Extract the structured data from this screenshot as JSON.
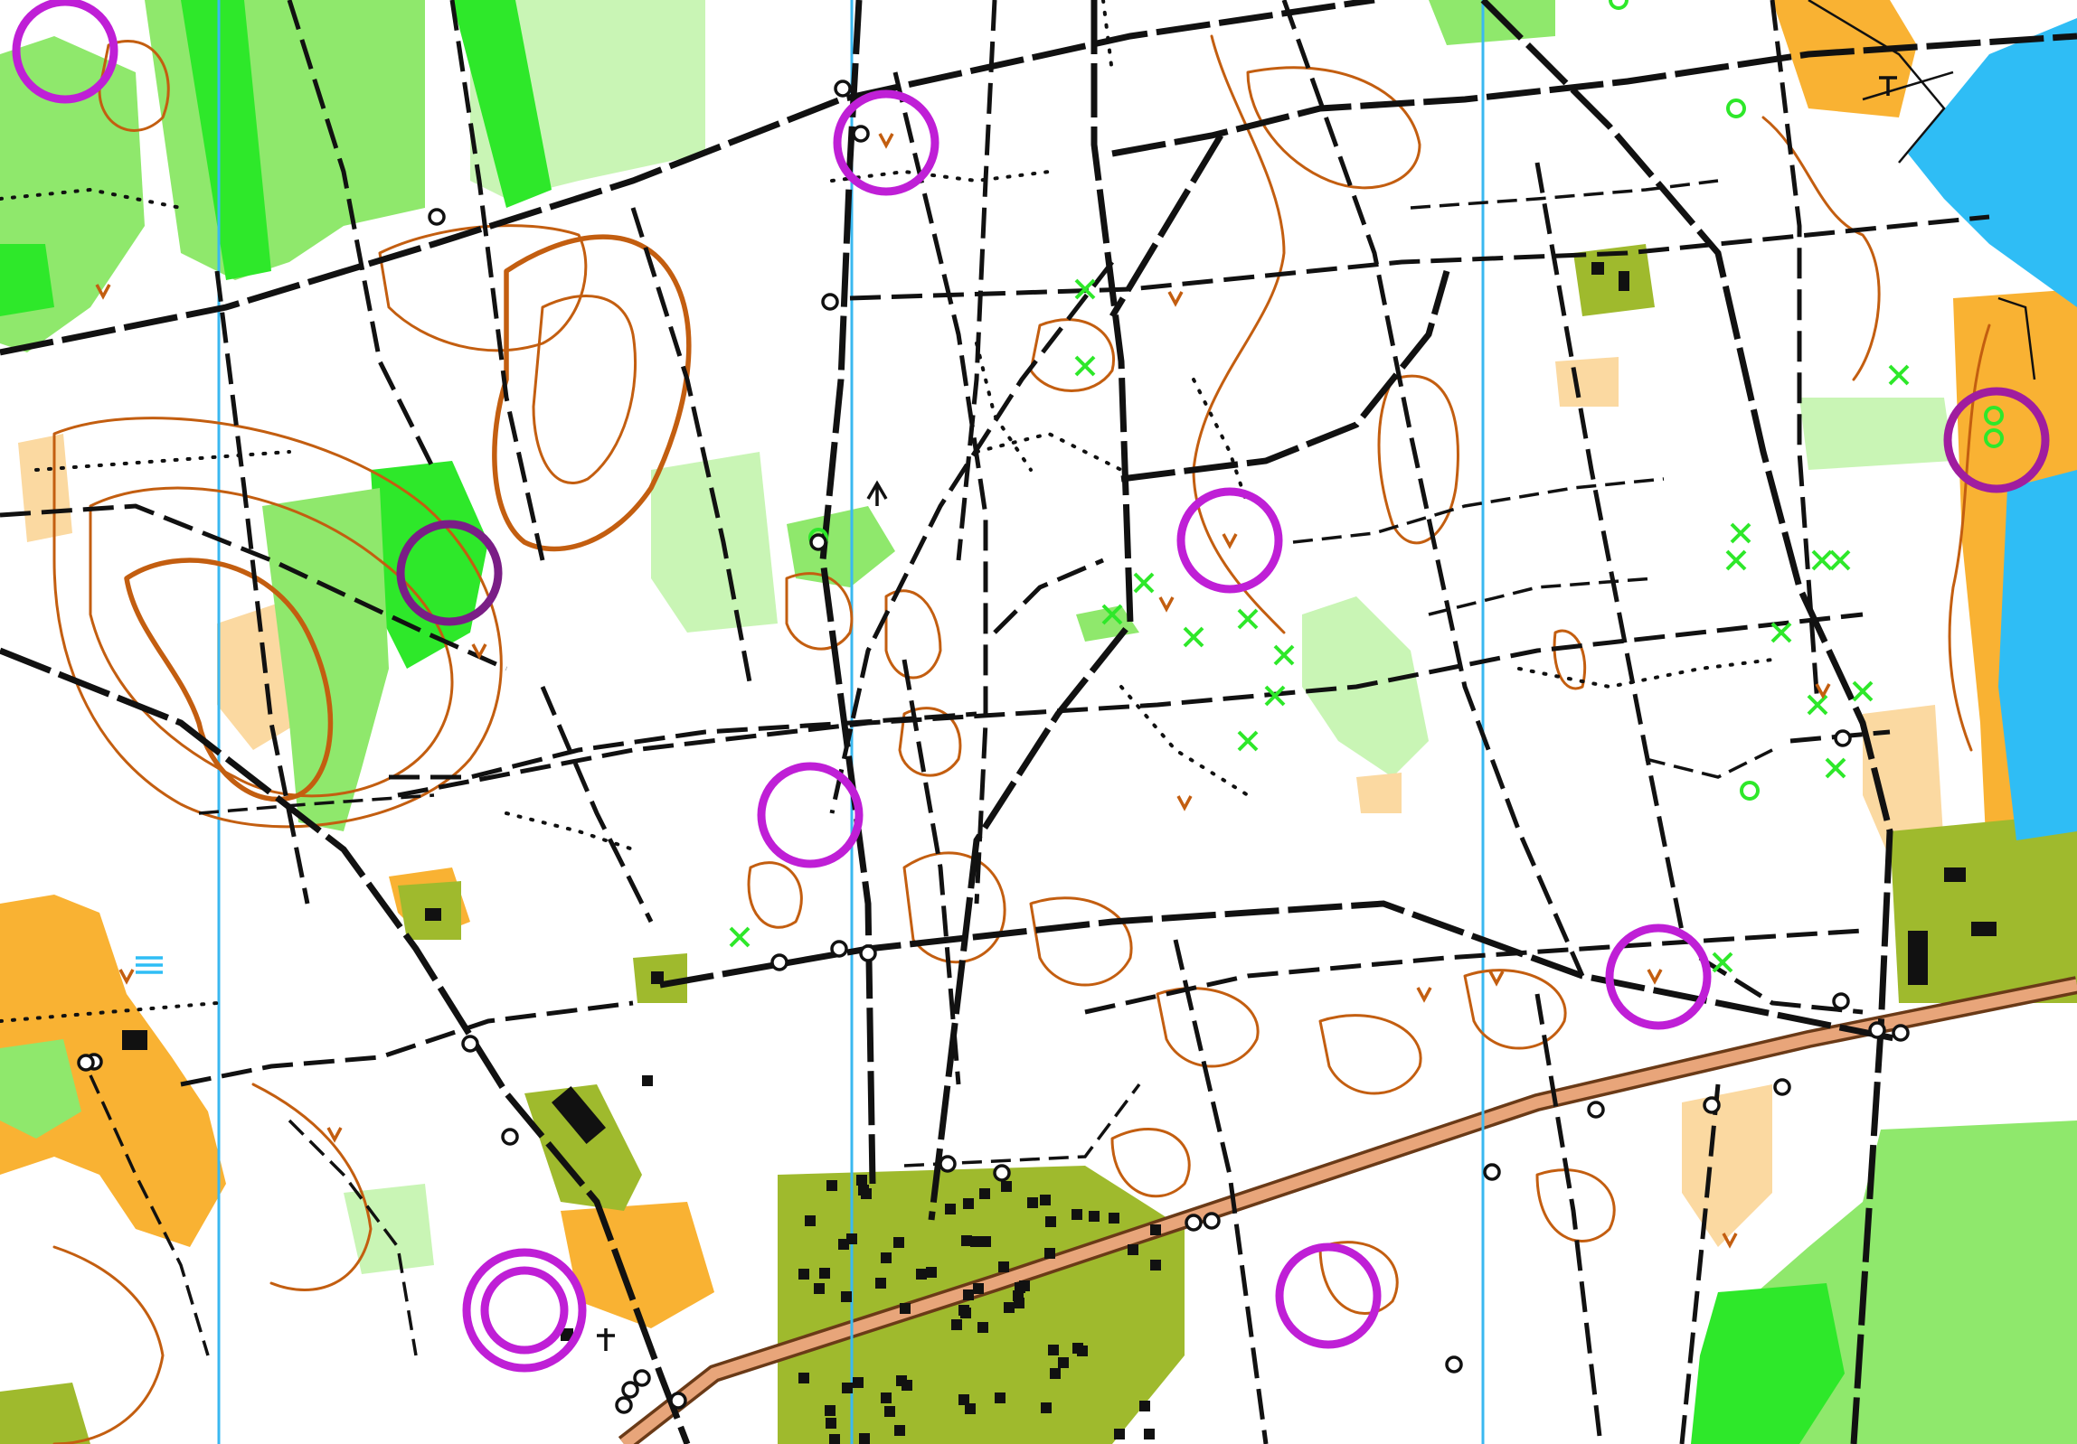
{
  "map": {
    "colors": {
      "white_forest": "#ffffff",
      "open_land": "#f9b233",
      "rough_open": "#fbd9a1",
      "slow_run": "#c9f5b5",
      "walk": "#8fe86c",
      "fight": "#2ee82a",
      "settlement": "#9fba2d",
      "water": "#2fbdf5",
      "contour": "#c35e10",
      "path": "#111111",
      "road": "#e8a57a",
      "magnetic_north": "#3ab8f0",
      "control_circle": "#bf1fd6"
    },
    "icons": {
      "control": "control-circle",
      "boulder": "boulder-circle-icon",
      "depression": "v-depression-icon",
      "special_feature": "green-cross-icon",
      "building": "building-square-icon",
      "tower": "tower-t-icon"
    }
  }
}
